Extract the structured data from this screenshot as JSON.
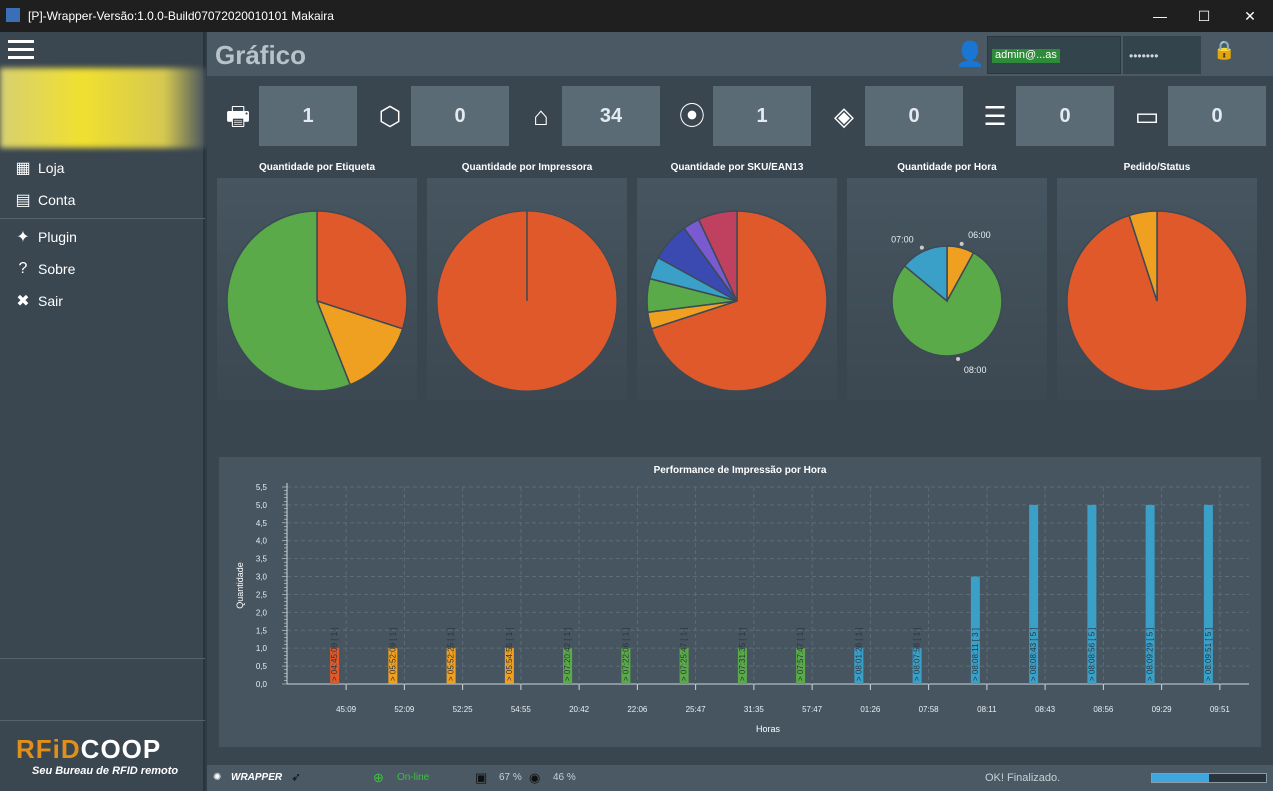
{
  "window": {
    "title": "[P]-Wrapper-Versão:1.0.0-Build07072020010101 Makaira",
    "minimize": "—",
    "maximize": "☐",
    "close": "✕"
  },
  "sidebar": {
    "items": [
      {
        "icon": "store-icon",
        "label": "Loja"
      },
      {
        "icon": "account-icon",
        "label": "Conta"
      },
      {
        "icon": "plugin-icon",
        "label": "Plugin"
      },
      {
        "icon": "help-icon",
        "label": "Sobre"
      },
      {
        "icon": "close-icon",
        "label": "Sair"
      }
    ],
    "brand": {
      "title_a": "RFiD",
      "title_b": "COOP",
      "subtitle": "Seu Bureau de RFID remoto"
    }
  },
  "header": {
    "title": "Gráfico",
    "user": "admin@...as",
    "password": "•••••••"
  },
  "stats": [
    {
      "icon": "printer-icon",
      "value": "1"
    },
    {
      "icon": "box-icon",
      "value": "0"
    },
    {
      "icon": "tag-icon",
      "value": "34"
    },
    {
      "icon": "location-icon",
      "value": "1"
    },
    {
      "icon": "tags-icon",
      "value": "0"
    },
    {
      "icon": "list-icon",
      "value": "0"
    },
    {
      "icon": "router-icon",
      "value": "0"
    }
  ],
  "colors": {
    "orange": "#e0592b",
    "amber": "#f0a020",
    "green": "#5aaa4a",
    "blue": "#3aa0c8",
    "purple": "#7a5ad0",
    "pink": "#c04060",
    "navy": "#3a4ab0"
  },
  "chart_data": [
    {
      "type": "pie",
      "title": "Quantidade por Etiqueta",
      "series": [
        {
          "values": [
            0.3,
            0.14,
            0.56
          ],
          "colors": [
            "#e0592b",
            "#f0a020",
            "#5aaa4a"
          ]
        }
      ]
    },
    {
      "type": "pie",
      "title": "Quantidade por Impressora",
      "series": [
        {
          "values": [
            1.0
          ],
          "colors": [
            "#e0592b"
          ]
        }
      ]
    },
    {
      "type": "pie",
      "title": "Quantidade por SKU/EAN13",
      "series": [
        {
          "values": [
            0.7,
            0.03,
            0.06,
            0.04,
            0.07,
            0.03,
            0.07
          ],
          "colors": [
            "#e0592b",
            "#f0a020",
            "#5aaa4a",
            "#3aa0c8",
            "#3a4ab0",
            "#7a5ad0",
            "#c04060"
          ]
        }
      ]
    },
    {
      "type": "pie",
      "title": "Quantidade por Hora",
      "labels": [
        "06:00",
        "08:00",
        "07:00"
      ],
      "series": [
        {
          "values": [
            0.08,
            0.78,
            0.14
          ],
          "colors": [
            "#f0a020",
            "#5aaa4a",
            "#3aa0c8"
          ]
        }
      ]
    },
    {
      "type": "pie",
      "title": "Pedido/Status",
      "series": [
        {
          "values": [
            0.95,
            0.05
          ],
          "colors": [
            "#e0592b",
            "#f0a020"
          ]
        }
      ]
    },
    {
      "type": "bar",
      "title": "Performance de Impressão por Hora",
      "xlabel": "Horas",
      "ylabel": "Quantidade",
      "ylim": [
        0,
        5.5
      ],
      "yticks": [
        "0,0",
        "0,5",
        "1,0",
        "1,5",
        "2,0",
        "2,5",
        "3,0",
        "3,5",
        "4,0",
        "4,5",
        "5,0",
        "5,5"
      ],
      "categories": [
        "45:09",
        "52:09",
        "52:25",
        "54:55",
        "20:42",
        "22:06",
        "25:47",
        "31:35",
        "57:47",
        "01:26",
        "07:58",
        "08:11",
        "08:43",
        "08:56",
        "09:29",
        "09:51"
      ],
      "values": [
        1,
        1,
        1,
        1,
        1,
        1,
        1,
        1,
        1,
        1,
        1,
        3,
        5,
        5,
        5,
        5
      ],
      "bar_labels": [
        "> 04:45:09 [ 1 ]",
        "> 05:52:09 [ 1 ]",
        "> 05:52:25 [ 1 ]",
        "> 05:54:55 [ 1 ]",
        "> 07:20:42 [ 1 ]",
        "> 07:22:06 [ 1 ]",
        "> 07:25:47 [ 1 ]",
        "> 07:31:35 [ 1 ]",
        "> 07:57:47 [ 1 ]",
        "> 08:01:26 [ 1 ]",
        "> 08:07:58 [ 1 ]",
        "> 08:08:11 [ 3 ]",
        "> 08:08:43 [ 5 ]",
        "> 08:08:56 [ 5 ]",
        "> 08:09:29 [ 5 ]",
        "> 08:09:51 [ 5 ]"
      ],
      "bar_colors": [
        "#e0592b",
        "#f0a020",
        "#f0a020",
        "#f0a020",
        "#5aaa4a",
        "#5aaa4a",
        "#5aaa4a",
        "#5aaa4a",
        "#5aaa4a",
        "#3aa0c8",
        "#3aa0c8",
        "#3aa0c8",
        "#3aa0c8",
        "#3aa0c8",
        "#3aa0c8",
        "#3aa0c8"
      ]
    }
  ],
  "status": {
    "brand": "WRAPPER",
    "online": "On-line",
    "cpu": "67 %",
    "disk": "46 %",
    "message": "OK! Finalizado.",
    "progress": 0.5
  }
}
